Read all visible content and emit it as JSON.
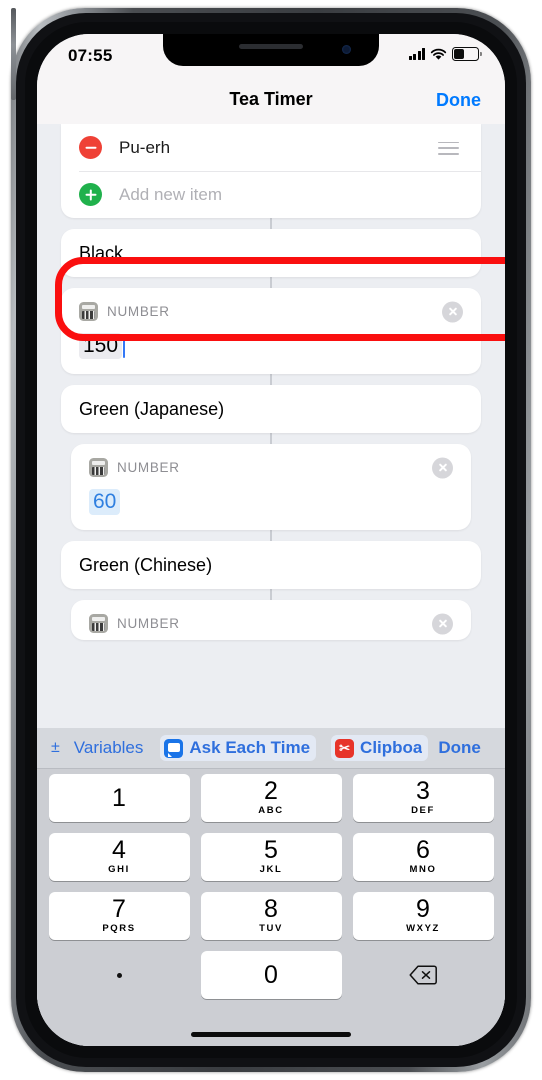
{
  "device": {
    "status_bar": {
      "time": "07:55",
      "signal_icon": "cellular-signal-icon",
      "wifi_icon": "wifi-icon",
      "battery_icon": "battery-icon",
      "battery_level_pct": 40
    },
    "home_indicator": "home-indicator"
  },
  "nav": {
    "title": "Tea Timer",
    "done_label": "Done"
  },
  "colors": {
    "accent_blue": "#007aff",
    "keyboard_blue": "#2f6fdd",
    "highlight_red": "#fa0f0f",
    "remove_red": "#ef4136",
    "add_green": "#20b14c",
    "token_blue": "#2f7fe0"
  },
  "list_card": {
    "rows": [
      {
        "icon": "remove-circle-icon",
        "label": "Pu-erh",
        "handle": "drag-handle-icon"
      },
      {
        "icon": "add-circle-icon",
        "label": "Add new item",
        "placeholder": true
      }
    ]
  },
  "blocks": [
    {
      "type": "name",
      "name": "Black"
    },
    {
      "type": "number",
      "icon": "calculator-icon",
      "label": "NUMBER",
      "value": "150",
      "clear_icon": "clear-circle-icon",
      "highlighted": true,
      "has_caret": true
    },
    {
      "type": "name",
      "name": "Green (Japanese)"
    },
    {
      "type": "number",
      "icon": "calculator-icon",
      "label": "NUMBER",
      "value": "60",
      "clear_icon": "clear-circle-icon",
      "highlighted": false,
      "token": true
    },
    {
      "type": "name",
      "name": "Green (Chinese)"
    },
    {
      "type": "number",
      "icon": "calculator-icon",
      "label": "NUMBER",
      "value": "",
      "clear_icon": "clear-circle-icon",
      "highlighted": false,
      "clipped": true
    }
  ],
  "accessory_bar": {
    "plus_minus": "±",
    "variables_label": "Variables",
    "ask_each_time": {
      "icon": "speech-bubble-icon",
      "label": "Ask Each Time"
    },
    "clipboard": {
      "icon": "scissors-icon",
      "icon_glyph": "✂",
      "label": "Clipboa"
    },
    "done_label": "Done"
  },
  "keypad": {
    "keys": [
      {
        "digit": "1",
        "letters": ""
      },
      {
        "digit": "2",
        "letters": "ABC"
      },
      {
        "digit": "3",
        "letters": "DEF"
      },
      {
        "digit": "4",
        "letters": "GHI"
      },
      {
        "digit": "5",
        "letters": "JKL"
      },
      {
        "digit": "6",
        "letters": "MNO"
      },
      {
        "digit": "7",
        "letters": "PQRS"
      },
      {
        "digit": "8",
        "letters": "TUV"
      },
      {
        "digit": "9",
        "letters": "WXYZ"
      },
      {
        "digit": ".",
        "letters": ""
      },
      {
        "digit": "0",
        "letters": ""
      },
      {
        "digit": "",
        "letters": "",
        "icon": "backspace-icon"
      }
    ]
  }
}
